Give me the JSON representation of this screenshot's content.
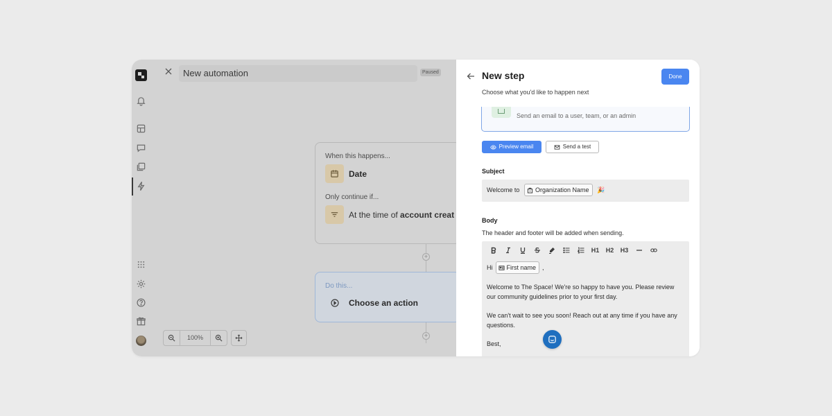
{
  "header": {
    "title": "New automation",
    "status_badge": "Paused"
  },
  "canvas": {
    "trigger_card": {
      "when_label": "When this happens...",
      "trigger_title": "Date",
      "condition_label": "Only continue if...",
      "condition_prefix": "At the time of ",
      "condition_bold": "account creat"
    },
    "action_card": {
      "do_label": "Do this...",
      "action_title": "Choose an action"
    },
    "zoom": {
      "level": "100%"
    }
  },
  "panel": {
    "title": "New step",
    "subtitle": "Choose what you'd like to happen next",
    "done_label": "Done",
    "email_option_description": "Send an email to a user, team, or an admin",
    "preview_label": "Preview email",
    "send_test_label": "Send a test",
    "subject_label": "Subject",
    "subject_prefix": "Welcome to",
    "subject_chip": "Organization Name",
    "subject_emoji": "🎉",
    "body_label": "Body",
    "body_hint": "The header and footer will be added when sending.",
    "toolbar": {
      "h1": "H1",
      "h2": "H2",
      "h3": "H3"
    },
    "editor": {
      "greeting": "Hi",
      "name_chip": "First name",
      "greeting_suffix": ",",
      "paragraph1": "Welcome to The Space! We're so happy to have you. Please review our community guidelines prior to your first day.",
      "paragraph2": "We can't wait to see you soon! Reach out at any time if you have any questions.",
      "signoff": "Best,"
    }
  },
  "colors": {
    "accent": "#4a86f0",
    "chat_bubble": "#1f6fbf"
  }
}
